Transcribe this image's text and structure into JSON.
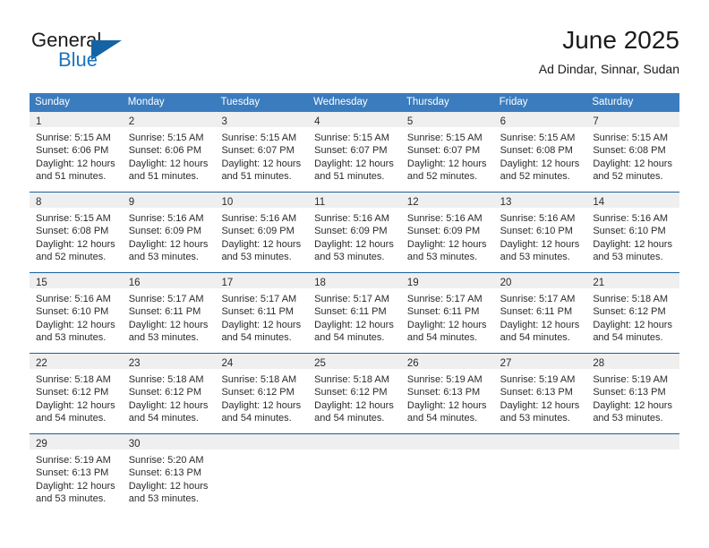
{
  "brand": {
    "word_one": "General",
    "word_two": "Blue",
    "triangle_icon": "triangle-icon",
    "accent_color": "#1d75bd",
    "triangle_color": "#1464a5"
  },
  "header": {
    "title": "June 2025",
    "subtitle": "Ad Dindar, Sinnar, Sudan"
  },
  "calendar": {
    "header_bg": "#3a7cbe",
    "week_rule_color": "#16619e",
    "daynum_band_bg": "#efeff0",
    "day_headers": [
      "Sunday",
      "Monday",
      "Tuesday",
      "Wednesday",
      "Thursday",
      "Friday",
      "Saturday"
    ],
    "weeks": [
      {
        "days": [
          {
            "day": "1",
            "lines": [
              "Sunrise: 5:15 AM",
              "Sunset: 6:06 PM",
              "Daylight: 12 hours",
              "and 51 minutes."
            ]
          },
          {
            "day": "2",
            "lines": [
              "Sunrise: 5:15 AM",
              "Sunset: 6:06 PM",
              "Daylight: 12 hours",
              "and 51 minutes."
            ]
          },
          {
            "day": "3",
            "lines": [
              "Sunrise: 5:15 AM",
              "Sunset: 6:07 PM",
              "Daylight: 12 hours",
              "and 51 minutes."
            ]
          },
          {
            "day": "4",
            "lines": [
              "Sunrise: 5:15 AM",
              "Sunset: 6:07 PM",
              "Daylight: 12 hours",
              "and 51 minutes."
            ]
          },
          {
            "day": "5",
            "lines": [
              "Sunrise: 5:15 AM",
              "Sunset: 6:07 PM",
              "Daylight: 12 hours",
              "and 52 minutes."
            ]
          },
          {
            "day": "6",
            "lines": [
              "Sunrise: 5:15 AM",
              "Sunset: 6:08 PM",
              "Daylight: 12 hours",
              "and 52 minutes."
            ]
          },
          {
            "day": "7",
            "lines": [
              "Sunrise: 5:15 AM",
              "Sunset: 6:08 PM",
              "Daylight: 12 hours",
              "and 52 minutes."
            ]
          }
        ]
      },
      {
        "days": [
          {
            "day": "8",
            "lines": [
              "Sunrise: 5:15 AM",
              "Sunset: 6:08 PM",
              "Daylight: 12 hours",
              "and 52 minutes."
            ]
          },
          {
            "day": "9",
            "lines": [
              "Sunrise: 5:16 AM",
              "Sunset: 6:09 PM",
              "Daylight: 12 hours",
              "and 53 minutes."
            ]
          },
          {
            "day": "10",
            "lines": [
              "Sunrise: 5:16 AM",
              "Sunset: 6:09 PM",
              "Daylight: 12 hours",
              "and 53 minutes."
            ]
          },
          {
            "day": "11",
            "lines": [
              "Sunrise: 5:16 AM",
              "Sunset: 6:09 PM",
              "Daylight: 12 hours",
              "and 53 minutes."
            ]
          },
          {
            "day": "12",
            "lines": [
              "Sunrise: 5:16 AM",
              "Sunset: 6:09 PM",
              "Daylight: 12 hours",
              "and 53 minutes."
            ]
          },
          {
            "day": "13",
            "lines": [
              "Sunrise: 5:16 AM",
              "Sunset: 6:10 PM",
              "Daylight: 12 hours",
              "and 53 minutes."
            ]
          },
          {
            "day": "14",
            "lines": [
              "Sunrise: 5:16 AM",
              "Sunset: 6:10 PM",
              "Daylight: 12 hours",
              "and 53 minutes."
            ]
          }
        ]
      },
      {
        "days": [
          {
            "day": "15",
            "lines": [
              "Sunrise: 5:16 AM",
              "Sunset: 6:10 PM",
              "Daylight: 12 hours",
              "and 53 minutes."
            ]
          },
          {
            "day": "16",
            "lines": [
              "Sunrise: 5:17 AM",
              "Sunset: 6:11 PM",
              "Daylight: 12 hours",
              "and 53 minutes."
            ]
          },
          {
            "day": "17",
            "lines": [
              "Sunrise: 5:17 AM",
              "Sunset: 6:11 PM",
              "Daylight: 12 hours",
              "and 54 minutes."
            ]
          },
          {
            "day": "18",
            "lines": [
              "Sunrise: 5:17 AM",
              "Sunset: 6:11 PM",
              "Daylight: 12 hours",
              "and 54 minutes."
            ]
          },
          {
            "day": "19",
            "lines": [
              "Sunrise: 5:17 AM",
              "Sunset: 6:11 PM",
              "Daylight: 12 hours",
              "and 54 minutes."
            ]
          },
          {
            "day": "20",
            "lines": [
              "Sunrise: 5:17 AM",
              "Sunset: 6:11 PM",
              "Daylight: 12 hours",
              "and 54 minutes."
            ]
          },
          {
            "day": "21",
            "lines": [
              "Sunrise: 5:18 AM",
              "Sunset: 6:12 PM",
              "Daylight: 12 hours",
              "and 54 minutes."
            ]
          }
        ]
      },
      {
        "days": [
          {
            "day": "22",
            "lines": [
              "Sunrise: 5:18 AM",
              "Sunset: 6:12 PM",
              "Daylight: 12 hours",
              "and 54 minutes."
            ]
          },
          {
            "day": "23",
            "lines": [
              "Sunrise: 5:18 AM",
              "Sunset: 6:12 PM",
              "Daylight: 12 hours",
              "and 54 minutes."
            ]
          },
          {
            "day": "24",
            "lines": [
              "Sunrise: 5:18 AM",
              "Sunset: 6:12 PM",
              "Daylight: 12 hours",
              "and 54 minutes."
            ]
          },
          {
            "day": "25",
            "lines": [
              "Sunrise: 5:18 AM",
              "Sunset: 6:12 PM",
              "Daylight: 12 hours",
              "and 54 minutes."
            ]
          },
          {
            "day": "26",
            "lines": [
              "Sunrise: 5:19 AM",
              "Sunset: 6:13 PM",
              "Daylight: 12 hours",
              "and 54 minutes."
            ]
          },
          {
            "day": "27",
            "lines": [
              "Sunrise: 5:19 AM",
              "Sunset: 6:13 PM",
              "Daylight: 12 hours",
              "and 53 minutes."
            ]
          },
          {
            "day": "28",
            "lines": [
              "Sunrise: 5:19 AM",
              "Sunset: 6:13 PM",
              "Daylight: 12 hours",
              "and 53 minutes."
            ]
          }
        ]
      },
      {
        "days": [
          {
            "day": "29",
            "lines": [
              "Sunrise: 5:19 AM",
              "Sunset: 6:13 PM",
              "Daylight: 12 hours",
              "and 53 minutes."
            ]
          },
          {
            "day": "30",
            "lines": [
              "Sunrise: 5:20 AM",
              "Sunset: 6:13 PM",
              "Daylight: 12 hours",
              "and 53 minutes."
            ]
          },
          {
            "day": "",
            "lines": []
          },
          {
            "day": "",
            "lines": []
          },
          {
            "day": "",
            "lines": []
          },
          {
            "day": "",
            "lines": []
          },
          {
            "day": "",
            "lines": []
          }
        ]
      }
    ]
  }
}
